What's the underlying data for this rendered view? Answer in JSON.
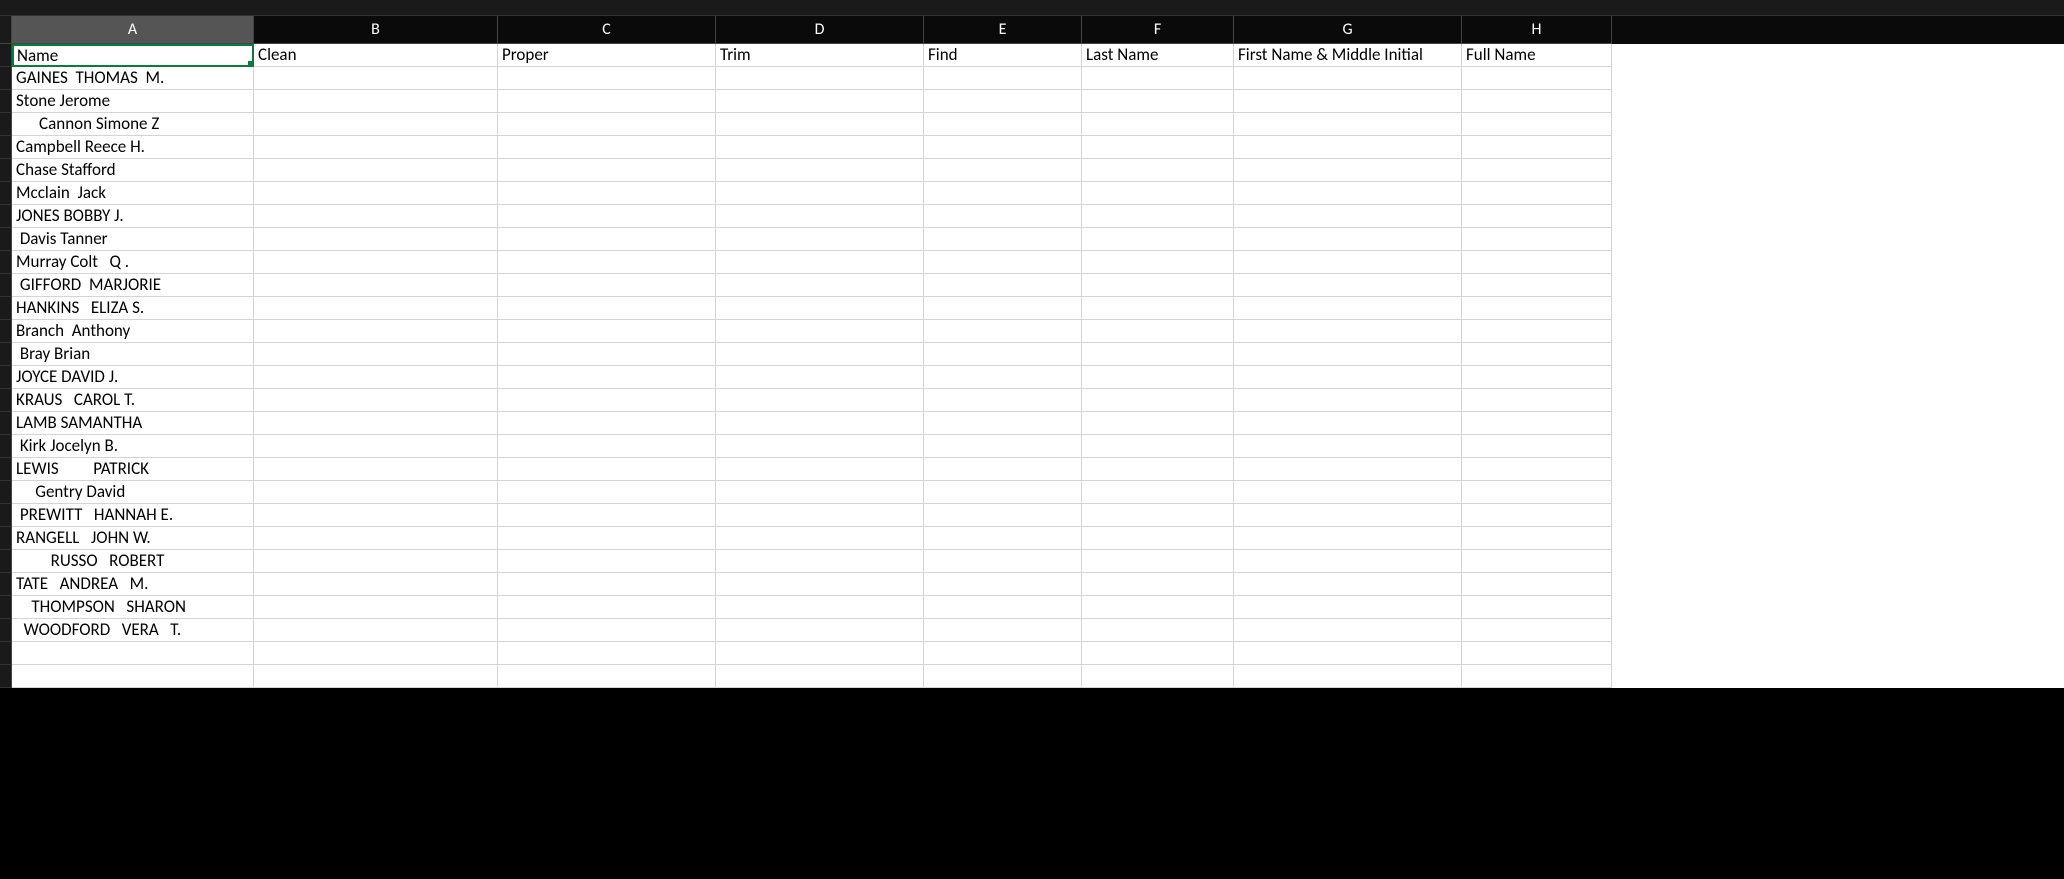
{
  "columns": [
    {
      "letter": "A",
      "class": "col-A",
      "selected": true
    },
    {
      "letter": "B",
      "class": "col-B",
      "selected": false
    },
    {
      "letter": "C",
      "class": "col-C",
      "selected": false
    },
    {
      "letter": "D",
      "class": "col-D",
      "selected": false
    },
    {
      "letter": "E",
      "class": "col-E",
      "selected": false
    },
    {
      "letter": "F",
      "class": "col-F",
      "selected": false
    },
    {
      "letter": "G",
      "class": "col-G",
      "selected": false
    },
    {
      "letter": "H",
      "class": "col-H",
      "selected": false
    }
  ],
  "activeCell": {
    "row": 0,
    "col": 0
  },
  "rows": [
    {
      "cells": [
        "Name",
        "Clean",
        "Proper",
        "Trim",
        "Find",
        "Last Name",
        "First Name & Middle Initial",
        "Full Name"
      ]
    },
    {
      "cells": [
        "GAINES  THOMAS  M.",
        "",
        "",
        "",
        "",
        "",
        "",
        ""
      ]
    },
    {
      "cells": [
        "Stone Jerome",
        "",
        "",
        "",
        "",
        "",
        "",
        ""
      ]
    },
    {
      "cells": [
        "      Cannon Simone Z",
        "",
        "",
        "",
        "",
        "",
        "",
        ""
      ]
    },
    {
      "cells": [
        "Campbell Reece H.",
        "",
        "",
        "",
        "",
        "",
        "",
        ""
      ]
    },
    {
      "cells": [
        "Chase Stafford",
        "",
        "",
        "",
        "",
        "",
        "",
        ""
      ]
    },
    {
      "cells": [
        "Mcclain  Jack",
        "",
        "",
        "",
        "",
        "",
        "",
        ""
      ]
    },
    {
      "cells": [
        "JONES BOBBY J.",
        "",
        "",
        "",
        "",
        "",
        "",
        ""
      ]
    },
    {
      "cells": [
        " Davis Tanner",
        "",
        "",
        "",
        "",
        "",
        "",
        ""
      ]
    },
    {
      "cells": [
        "Murray Colt   Q .",
        "",
        "",
        "",
        "",
        "",
        "",
        ""
      ]
    },
    {
      "cells": [
        " GIFFORD  MARJORIE",
        "",
        "",
        "",
        "",
        "",
        "",
        ""
      ]
    },
    {
      "cells": [
        "HANKINS   ELIZA S.",
        "",
        "",
        "",
        "",
        "",
        "",
        ""
      ]
    },
    {
      "cells": [
        "Branch  Anthony",
        "",
        "",
        "",
        "",
        "",
        "",
        ""
      ]
    },
    {
      "cells": [
        " Bray Brian",
        "",
        "",
        "",
        "",
        "",
        "",
        ""
      ]
    },
    {
      "cells": [
        "JOYCE DAVID J.",
        "",
        "",
        "",
        "",
        "",
        "",
        ""
      ]
    },
    {
      "cells": [
        "KRAUS   CAROL T.",
        "",
        "",
        "",
        "",
        "",
        "",
        ""
      ]
    },
    {
      "cells": [
        "LAMB SAMANTHA",
        "",
        "",
        "",
        "",
        "",
        "",
        ""
      ]
    },
    {
      "cells": [
        " Kirk Jocelyn B.",
        "",
        "",
        "",
        "",
        "",
        "",
        ""
      ]
    },
    {
      "cells": [
        "LEWIS         PATRICK",
        "",
        "",
        "",
        "",
        "",
        "",
        ""
      ]
    },
    {
      "cells": [
        "     Gentry David",
        "",
        "",
        "",
        "",
        "",
        "",
        ""
      ]
    },
    {
      "cells": [
        " PREWITT   HANNAH E.",
        "",
        "",
        "",
        "",
        "",
        "",
        ""
      ]
    },
    {
      "cells": [
        "RANGELL   JOHN W.",
        "",
        "",
        "",
        "",
        "",
        "",
        ""
      ]
    },
    {
      "cells": [
        "         RUSSO   ROBERT",
        "",
        "",
        "",
        "",
        "",
        "",
        ""
      ]
    },
    {
      "cells": [
        "TATE   ANDREA   M.",
        "",
        "",
        "",
        "",
        "",
        "",
        ""
      ]
    },
    {
      "cells": [
        "    THOMPSON   SHARON",
        "",
        "",
        "",
        "",
        "",
        "",
        ""
      ]
    },
    {
      "cells": [
        "  WOODFORD   VERA   T.",
        "",
        "",
        "",
        "",
        "",
        "",
        ""
      ]
    },
    {
      "cells": [
        "",
        "",
        "",
        "",
        "",
        "",
        "",
        ""
      ]
    },
    {
      "cells": [
        "",
        "",
        "",
        "",
        "",
        "",
        "",
        ""
      ]
    }
  ]
}
